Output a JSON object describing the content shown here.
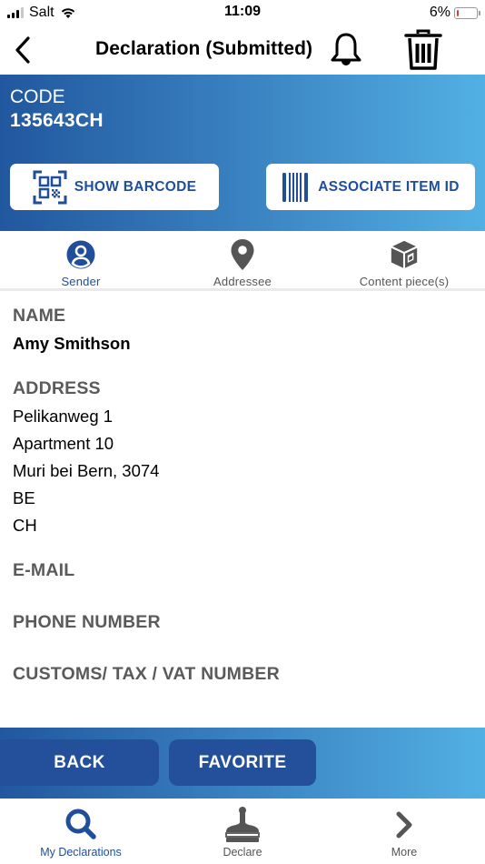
{
  "status_bar": {
    "carrier": "Salt",
    "time": "11:09",
    "battery_percent_label": "6%",
    "battery_level": 0.06,
    "signal_bars_active": 3,
    "signal_bars_total": 4
  },
  "nav": {
    "title": "Declaration (Submitted)",
    "back_icon": "chevron-left-icon",
    "bell_icon": "bell-icon",
    "trash_icon": "trash-icon"
  },
  "header": {
    "code_label": "CODE",
    "code_value": "135643CH",
    "show_barcode_label": "SHOW BARCODE",
    "associate_item_label": "ASSOCIATE ITEM ID",
    "colors": {
      "gradient_start": "#21579e",
      "gradient_end": "#52b0e4",
      "button_text": "#1f4e9a"
    }
  },
  "tabs": [
    {
      "label": "Sender",
      "icon": "user-circle-icon",
      "active": true
    },
    {
      "label": "Addressee",
      "icon": "map-pin-icon",
      "active": false
    },
    {
      "label": "Content piece(s)",
      "icon": "box-icon",
      "active": false
    }
  ],
  "sender": {
    "name_label": "NAME",
    "name_value": "Amy Smithson",
    "address_label": "ADDRESS",
    "address_lines": [
      "Pelikanweg 1",
      "Apartment 10",
      "Muri bei Bern, 3074",
      "BE",
      "CH"
    ],
    "email_label": "E-MAIL",
    "phone_label": "PHONE NUMBER",
    "customs_label": "CUSTOMS/ TAX / VAT NUMBER"
  },
  "actions": {
    "back_label": "BACK",
    "favorite_label": "FAVORITE"
  },
  "tab_bar": [
    {
      "label": "My Declarations",
      "icon": "search-icon",
      "active": true
    },
    {
      "label": "Declare",
      "icon": "stamp-icon",
      "active": false
    },
    {
      "label": "More",
      "icon": "chevron-right-icon",
      "active": false
    }
  ],
  "colors": {
    "accent": "#1f4e9a",
    "label_gray": "#5a5a5a",
    "icon_gray": "#555555"
  }
}
